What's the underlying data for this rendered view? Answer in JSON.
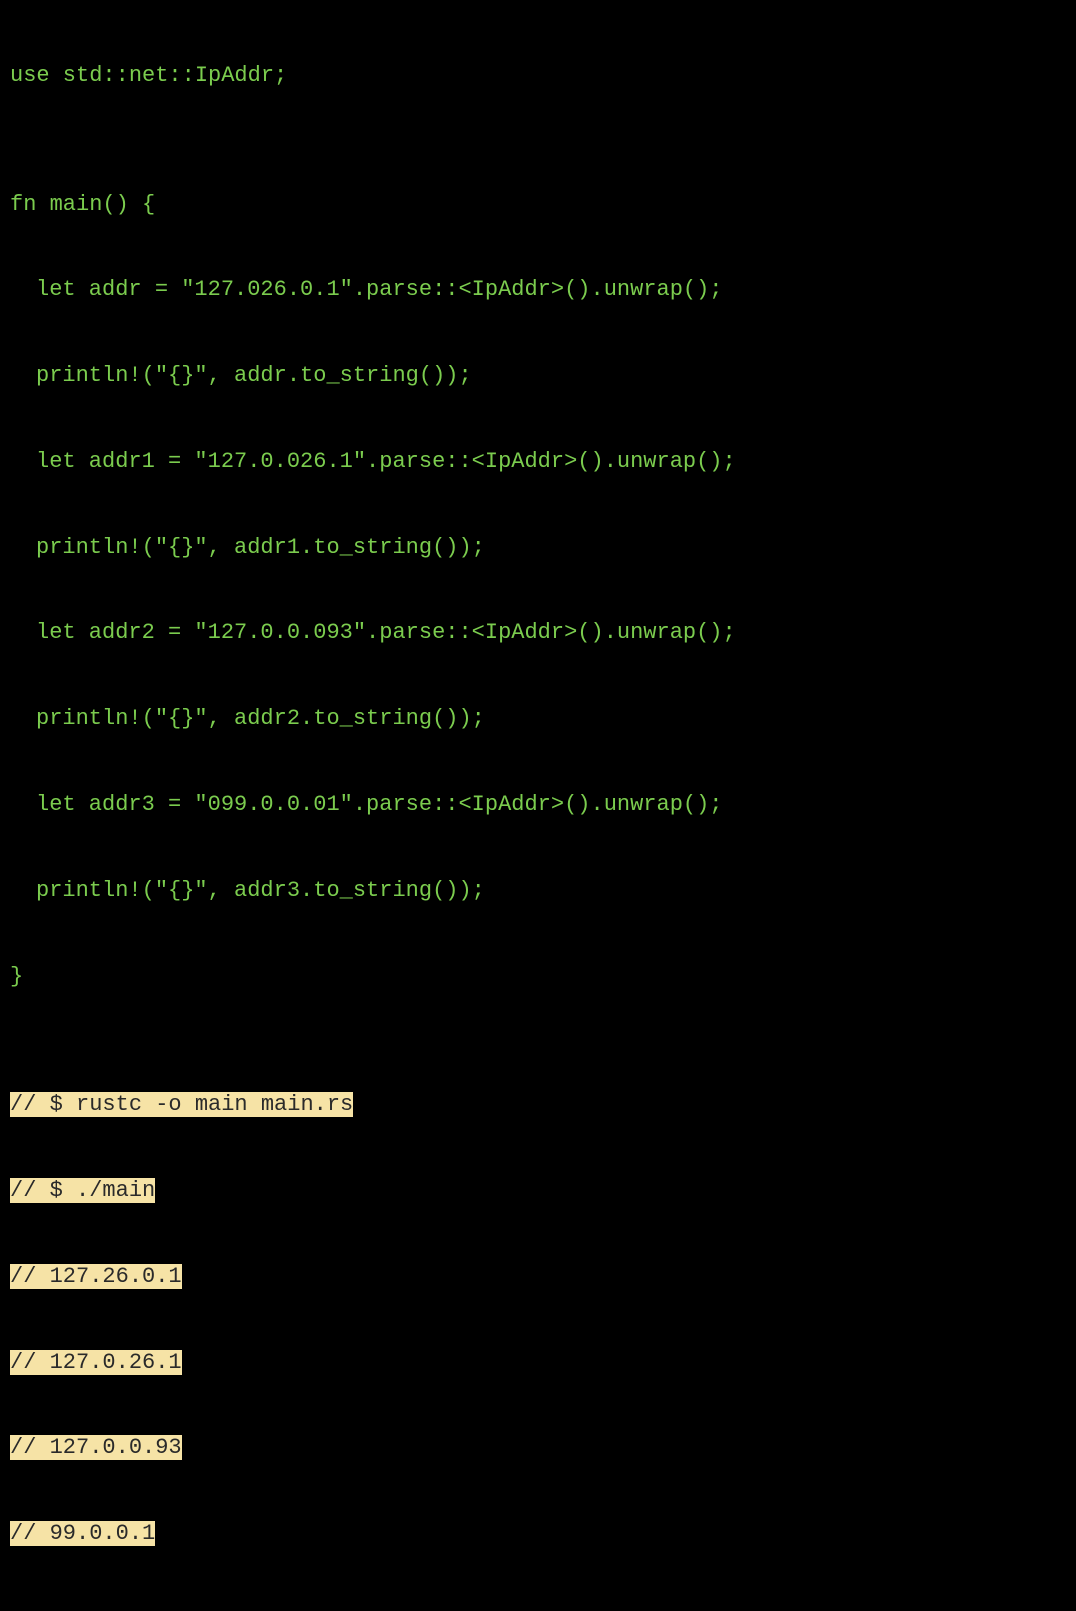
{
  "code": {
    "line1": "use std::net::IpAddr;",
    "line2": "",
    "line3": "fn main() {",
    "line4": "let addr = \"127.026.0.1\".parse::<IpAddr>().unwrap();",
    "line5": "println!(\"{}\", addr.to_string());",
    "line6": "let addr1 = \"127.0.026.1\".parse::<IpAddr>().unwrap();",
    "line7": "println!(\"{}\", addr1.to_string());",
    "line8": "let addr2 = \"127.0.0.093\".parse::<IpAddr>().unwrap();",
    "line9": "println!(\"{}\", addr2.to_string());",
    "line10": "let addr3 = \"099.0.0.01\".parse::<IpAddr>().unwrap();",
    "line11": "println!(\"{}\", addr3.to_string());",
    "line12": "}",
    "line13": "",
    "comment1": "// $ rustc -o main main.rs",
    "comment2": "// $ ./main",
    "comment3": "// 127.26.0.1",
    "comment4": "// 127.0.26.1",
    "comment5": "// 127.0.0.93",
    "comment6": "// 99.0.0.1"
  }
}
